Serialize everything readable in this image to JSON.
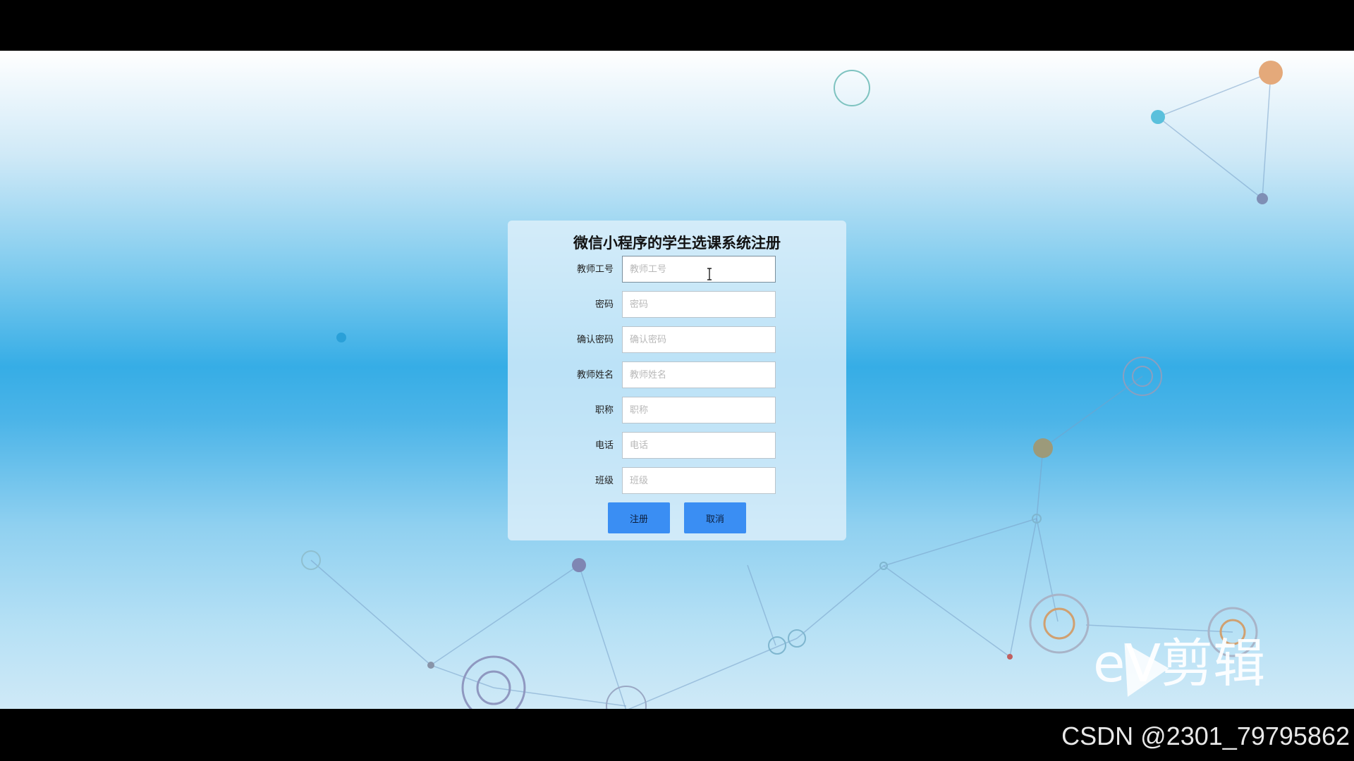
{
  "form": {
    "title": "微信小程序的学生选课系统注册",
    "fields": [
      {
        "label": "教师工号",
        "placeholder": "教师工号",
        "value": ""
      },
      {
        "label": "密码",
        "placeholder": "密码",
        "value": ""
      },
      {
        "label": "确认密码",
        "placeholder": "确认密码",
        "value": ""
      },
      {
        "label": "教师姓名",
        "placeholder": "教师姓名",
        "value": ""
      },
      {
        "label": "职称",
        "placeholder": "职称",
        "value": ""
      },
      {
        "label": "电话",
        "placeholder": "电话",
        "value": ""
      },
      {
        "label": "班级",
        "placeholder": "班级",
        "value": ""
      }
    ],
    "register_label": "注册",
    "cancel_label": "取消"
  },
  "watermark": {
    "editor_brand": "eV剪辑",
    "csdn_credit": "CSDN @2301_79795862"
  },
  "colors": {
    "button": "#3a8ef3",
    "background_top": "#ffffff",
    "background_mid": "#36ade6",
    "panel": "#e2f1fb"
  },
  "icons": {
    "cursor": "text-cursor-icon",
    "logo": "play-triangle-logo-icon"
  }
}
